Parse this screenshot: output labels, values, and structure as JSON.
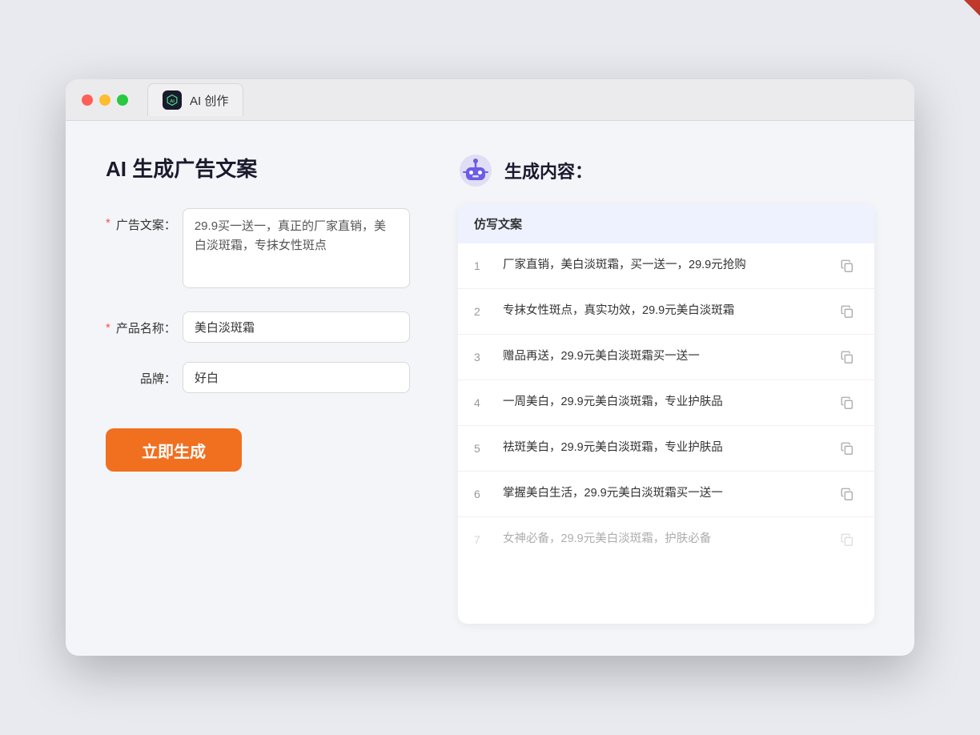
{
  "window": {
    "tab_icon_label": "AI",
    "tab_title": "AI 创作"
  },
  "left_panel": {
    "title": "AI 生成广告文案",
    "form": {
      "ad_copy_label": "广告文案：",
      "ad_copy_required": "*",
      "ad_copy_value": "29.9买一送一，真正的厂家直销，美白淡斑霜，专抹女性斑点",
      "product_name_label": "产品名称：",
      "product_name_required": "*",
      "product_name_value": "美白淡斑霜",
      "brand_label": "品牌：",
      "brand_value": "好白"
    },
    "generate_btn_label": "立即生成"
  },
  "right_panel": {
    "title": "生成内容：",
    "column_header": "仿写文案",
    "results": [
      {
        "num": "1",
        "text": "厂家直销，美白淡斑霜，买一送一，29.9元抢购",
        "faded": false
      },
      {
        "num": "2",
        "text": "专抹女性斑点，真实功效，29.9元美白淡斑霜",
        "faded": false
      },
      {
        "num": "3",
        "text": "赠品再送，29.9元美白淡斑霜买一送一",
        "faded": false
      },
      {
        "num": "4",
        "text": "一周美白，29.9元美白淡斑霜，专业护肤品",
        "faded": false
      },
      {
        "num": "5",
        "text": "祛斑美白，29.9元美白淡斑霜，专业护肤品",
        "faded": false
      },
      {
        "num": "6",
        "text": "掌握美白生活，29.9元美白淡斑霜买一送一",
        "faded": false
      },
      {
        "num": "7",
        "text": "女神必备，29.9元美白淡斑霜，护肤必备",
        "faded": true
      }
    ]
  },
  "colors": {
    "accent": "#f07020",
    "primary": "#1a1a2e",
    "required": "#ff4d4f"
  }
}
